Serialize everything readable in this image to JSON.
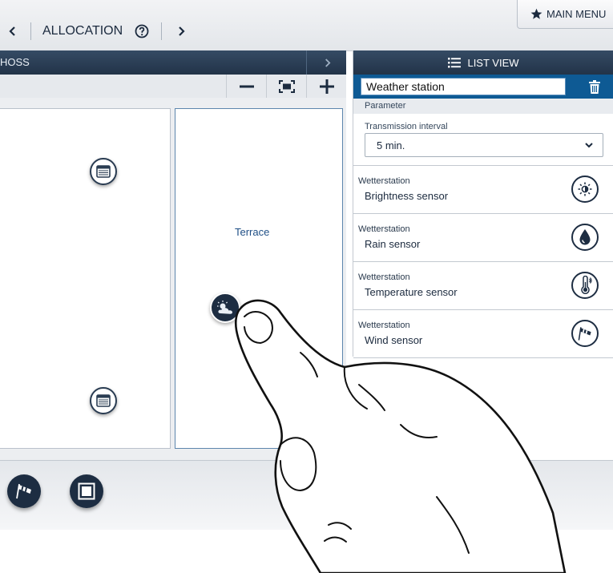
{
  "topbar": {
    "back_icon": "chevron-left-icon",
    "title": "ALLOCATION",
    "help_icon": "question-circle-icon",
    "forward_icon": "chevron-right-icon",
    "main_menu_label": "MAIN MENU",
    "main_menu_icon": "star-icon"
  },
  "floorplan": {
    "floor_name": "HOSS",
    "next_icon": "chevron-right-icon",
    "zoom_out_icon": "minus-icon",
    "fit_icon": "fit-screen-icon",
    "zoom_in_icon": "plus-icon",
    "rooms": [
      {
        "label": ""
      },
      {
        "label": "Terrace"
      }
    ],
    "devices": [
      {
        "icon": "blind-icon"
      },
      {
        "icon": "blind-icon"
      },
      {
        "icon": "weather-station-icon"
      }
    ]
  },
  "tray": {
    "items": [
      {
        "icon": "wind-sensor-icon"
      },
      {
        "icon": "window-icon"
      }
    ]
  },
  "panel": {
    "header_label": "LIST VIEW",
    "header_icon": "list-icon",
    "device_name": "Weather station",
    "delete_icon": "trash-icon",
    "parameter_heading": "Parameter",
    "interval": {
      "label": "Transmission interval",
      "value": "5 min."
    },
    "sensors": [
      {
        "group": "Wetterstation",
        "name": "Brightness sensor",
        "icon": "sun-icon"
      },
      {
        "group": "Wetterstation",
        "name": "Rain sensor",
        "icon": "raindrop-icon"
      },
      {
        "group": "Wetterstation",
        "name": "Temperature sensor",
        "icon": "thermometer-icon"
      },
      {
        "group": "Wetterstation",
        "name": "Wind sensor",
        "icon": "windsock-icon"
      }
    ]
  },
  "colors": {
    "header_dark": "#223348",
    "accent_blue": "#0e5a94",
    "icon_navy": "#1d2d42"
  }
}
